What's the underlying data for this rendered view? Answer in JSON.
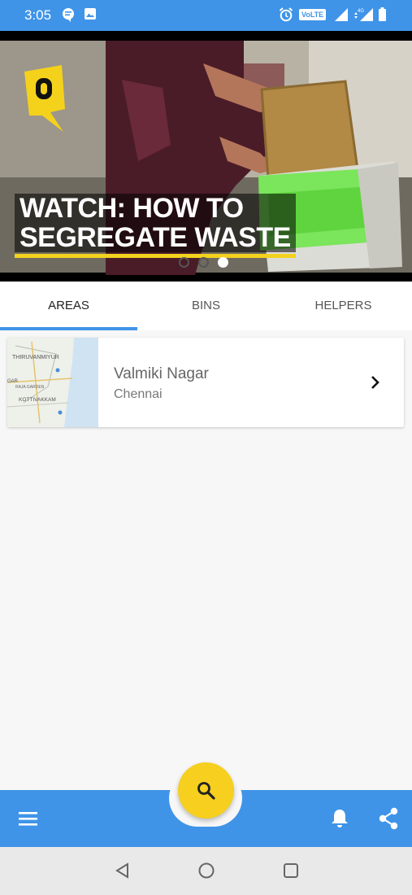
{
  "status_bar": {
    "time": "3:05",
    "volte_label": "VoLTE",
    "icons": [
      "chat-notification-icon",
      "image-notification-icon",
      "alarm-icon",
      "volte-icon",
      "signal-icon",
      "4g-signal-icon",
      "battery-icon"
    ]
  },
  "banner": {
    "caption_line1": "WATCH: HOW TO",
    "caption_line2": "SEGREGATE WASTE",
    "logo_icon": "the-quint-logo",
    "pages": 3,
    "active_page": 3
  },
  "tabs": [
    {
      "label": "AREAS",
      "active": true
    },
    {
      "label": "BINS",
      "active": false
    },
    {
      "label": "HELPERS",
      "active": false
    }
  ],
  "areas": [
    {
      "name": "Valmiki Nagar",
      "city": "Chennai",
      "thumbnail": "map-thumbnail"
    }
  ],
  "bottom_bar": {
    "menu_icon": "menu-icon",
    "fab_icon": "search-icon",
    "notification_icon": "bell-icon",
    "share_icon": "share-icon"
  },
  "nav_bar": {
    "icons": [
      "back-icon",
      "home-icon",
      "recents-icon"
    ]
  },
  "colors": {
    "primary": "#3f94e8",
    "accent": "#f6cf1f",
    "background": "#f7f7f7"
  }
}
